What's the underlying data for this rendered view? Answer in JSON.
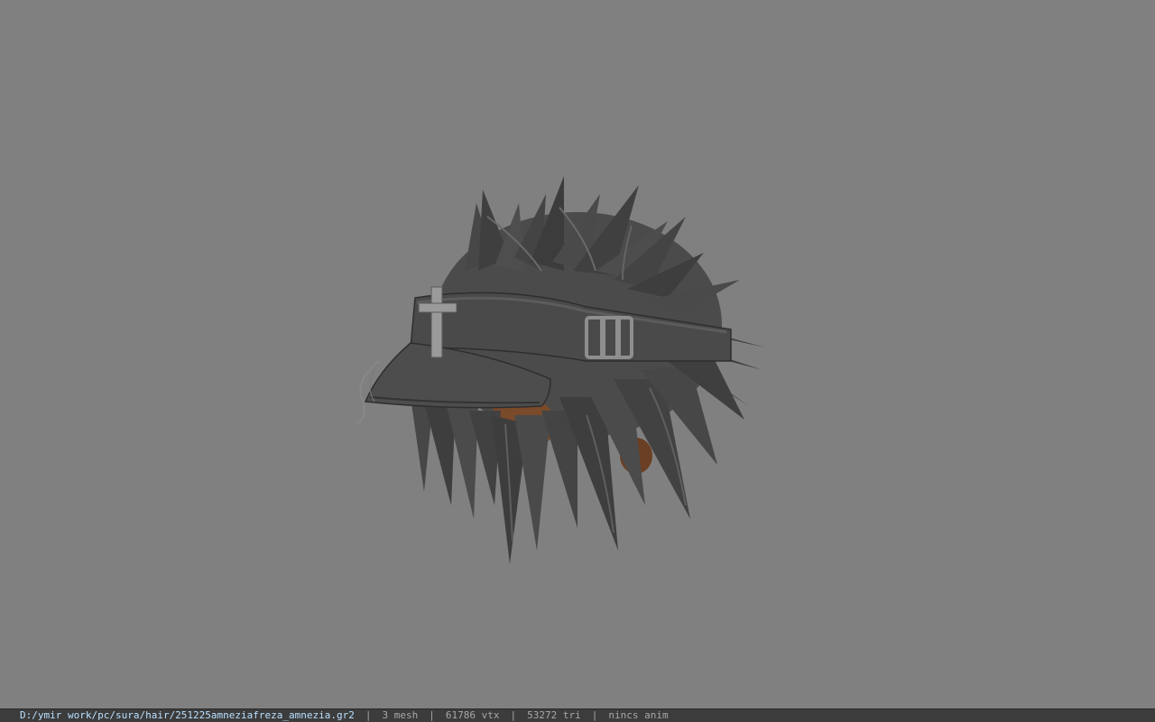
{
  "viewport": {
    "background": "#808080",
    "model": {
      "kind": "hair-with-visor-cap",
      "colors": {
        "hair_dark": "#3e3e3e",
        "hair_mid": "#4b4b4b",
        "hair_light": "#5a5a5a",
        "cap": "#4a4a4a",
        "cap_light": "#5c5c5c",
        "metal": "#9a9a9a",
        "skin": "#7a4a2a"
      },
      "icons": [
        "cross-ornament-icon",
        "buckle-icon"
      ]
    }
  },
  "statusbar": {
    "file_path": "D:/ymir work/pc/sura/hair/251225amneziafreza_amnezia.gr2",
    "separator": "|",
    "mesh": "3 mesh",
    "vertices": "61786 vtx",
    "triangles": "53272 tri",
    "animation": "nincs anim",
    "background": "#3c3c3c",
    "text_color": "#a8a8a8",
    "path_color": "#b9e0ff"
  }
}
